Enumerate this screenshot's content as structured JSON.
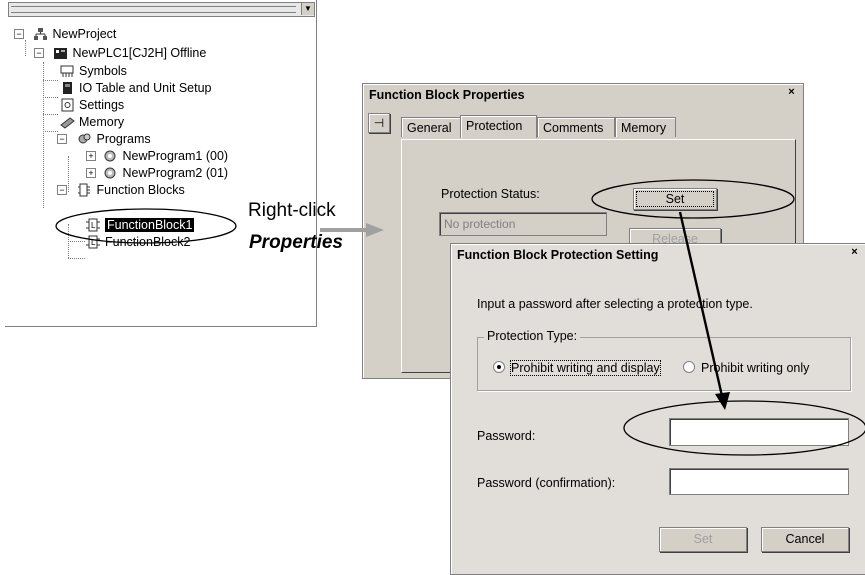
{
  "tree": {
    "items": [
      {
        "label": "NewProject",
        "icon": "project-icon",
        "expander": "−"
      },
      {
        "label": "NewPLC1[CJ2H] Offline",
        "icon": "plc-icon",
        "expander": "−"
      },
      {
        "label": "Symbols",
        "icon": "symbols-icon"
      },
      {
        "label": "IO Table and Unit Setup",
        "icon": "io-table-icon"
      },
      {
        "label": "Settings",
        "icon": "settings-icon"
      },
      {
        "label": "Memory",
        "icon": "memory-icon"
      },
      {
        "label": "Programs",
        "icon": "programs-icon",
        "expander": "−"
      },
      {
        "label": "NewProgram1 (00)",
        "icon": "program-icon",
        "expander": "+"
      },
      {
        "label": "NewProgram2 (01)",
        "icon": "program-icon",
        "expander": "+"
      },
      {
        "label": "Function Blocks",
        "icon": "function-blocks-icon",
        "expander": "−"
      },
      {
        "label": "FunctionBlock1",
        "icon": "function-block-icon"
      },
      {
        "label": "FunctionBlock2",
        "icon": "function-block-icon"
      }
    ]
  },
  "callouts": {
    "right_click": "Right-click",
    "properties": "Properties"
  },
  "properties_dialog": {
    "title": "Function Block Properties",
    "close": "×",
    "pin": "⊣",
    "tabs": [
      "General",
      "Protection",
      "Comments",
      "Memory"
    ],
    "active_tab": "Protection",
    "status_label": "Protection Status:",
    "status_value": "No protection",
    "set_button": "Set",
    "release_button": "Release"
  },
  "protection_dialog": {
    "title": "Function Block Protection Setting",
    "close": "×",
    "instruction": "Input a password after selecting a protection type.",
    "group_label": "Protection Type:",
    "options": [
      "Prohibit writing and display",
      "Prohibit writing only"
    ],
    "selected_option": "Prohibit writing and display",
    "password_label": "Password:",
    "password_value": "",
    "confirm_label": "Password (confirmation):",
    "confirm_value": "",
    "set_button": "Set",
    "cancel_button": "Cancel"
  },
  "colors": {
    "dialog_bg": "#d4d0c8",
    "selection": "#000000",
    "arrow": "#a0a0a0"
  }
}
